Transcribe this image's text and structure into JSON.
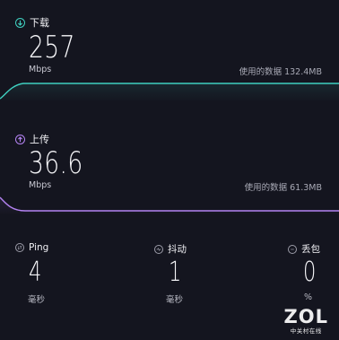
{
  "download": {
    "label": "下载",
    "value": "257",
    "unit": "Mbps",
    "data_used": "使用的数据 132.4MB",
    "line_color": "#3fd0c0"
  },
  "upload": {
    "label": "上传",
    "value": "36.6",
    "unit": "Mbps",
    "data_used": "使用的数据 61.3MB",
    "line_color": "#b483f2"
  },
  "stats": {
    "ping": {
      "label": "Ping",
      "value": "4",
      "unit": "毫秒",
      "icon": "ping-icon"
    },
    "jitter": {
      "label": "抖动",
      "value": "1",
      "unit": "毫秒",
      "icon": "jitter-icon"
    },
    "loss": {
      "label": "丢包",
      "value": "0",
      "unit": "%",
      "icon": "packet-loss-icon"
    }
  },
  "watermark": {
    "logo": "ZOL",
    "subtitle": "中关村在线"
  }
}
